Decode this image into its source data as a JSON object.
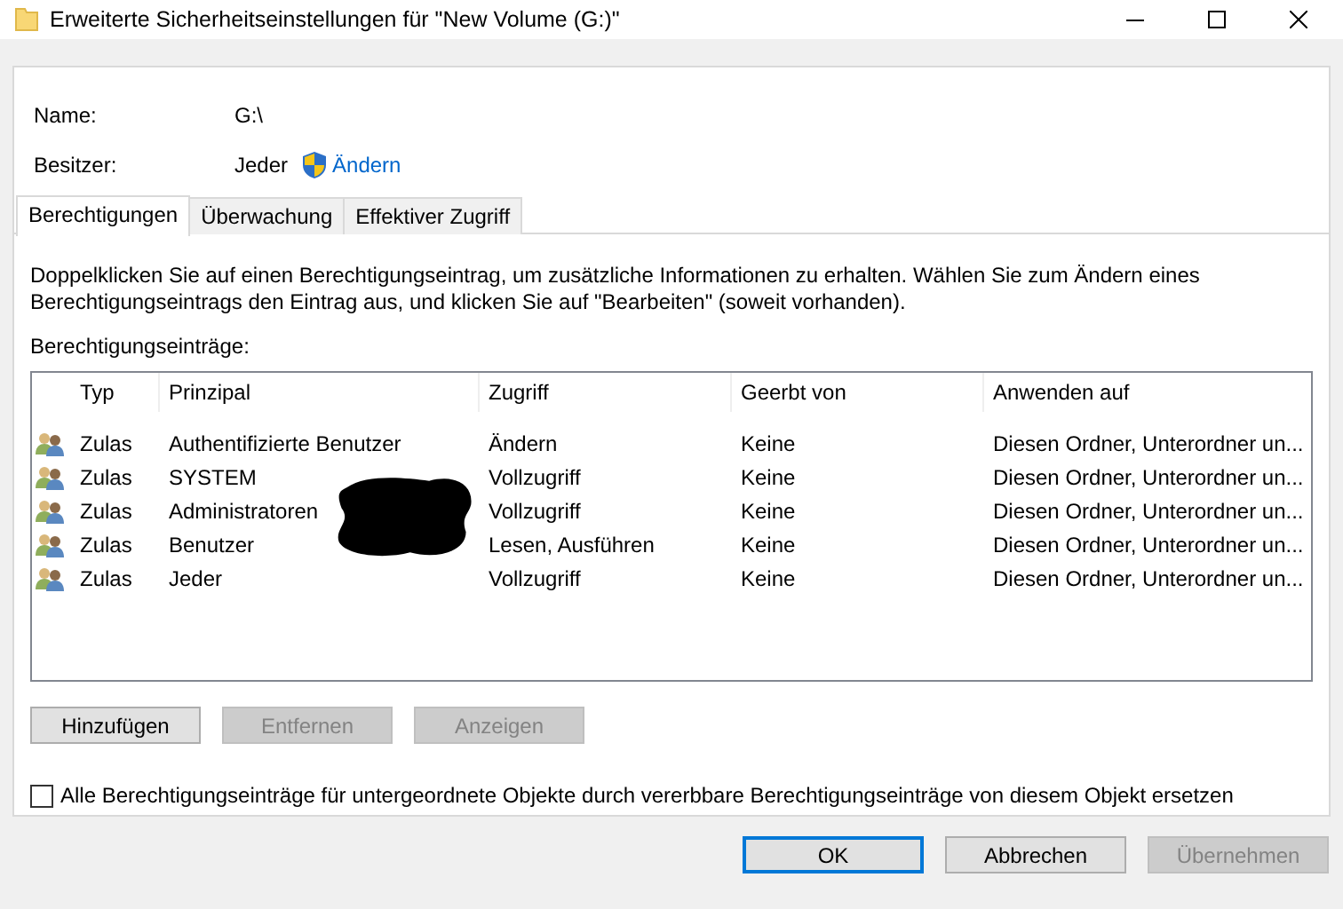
{
  "window": {
    "title": "Erweiterte Sicherheitseinstellungen für \"New Volume (G:)\""
  },
  "name": {
    "label": "Name:",
    "value": "G:\\"
  },
  "owner": {
    "label": "Besitzer:",
    "value": "Jeder",
    "link": "Ändern"
  },
  "tabs": [
    {
      "label": "Berechtigungen",
      "selected": true
    },
    {
      "label": "Überwachung",
      "selected": false
    },
    {
      "label": "Effektiver Zugriff",
      "selected": false
    }
  ],
  "description": "Doppelklicken Sie auf einen Berechtigungseintrag, um zusätzliche Informationen zu erhalten. Wählen Sie zum Ändern eines Berechtigungseintrags den Eintrag aus, und klicken Sie auf \"Bearbeiten\" (soweit vorhanden).",
  "entries_label": "Berechtigungseinträge:",
  "table": {
    "columns": [
      "Typ",
      "Prinzipal",
      "Zugriff",
      "Geerbt von",
      "Anwenden auf"
    ],
    "rows": [
      {
        "cells": [
          "Zulas",
          "Authentifizierte Benutzer",
          "Ändern",
          "Keine",
          "Diesen Ordner, Unterordner un..."
        ]
      },
      {
        "cells": [
          "Zulas",
          "SYSTEM",
          "Vollzugriff",
          "Keine",
          "Diesen Ordner, Unterordner un..."
        ]
      },
      {
        "cells": [
          "Zulas",
          "Administratoren",
          "Vollzugriff",
          "Keine",
          "Diesen Ordner, Unterordner un..."
        ]
      },
      {
        "cells": [
          "Zulas",
          "Benutzer",
          "Lesen, Ausführen",
          "Keine",
          "Diesen Ordner, Unterordner un..."
        ]
      },
      {
        "cells": [
          "Zulas",
          "Jeder",
          "Vollzugriff",
          "Keine",
          "Diesen Ordner, Unterordner un..."
        ]
      }
    ]
  },
  "entry_buttons": [
    {
      "label": "Hinzufügen",
      "disabled": false
    },
    {
      "label": "Entfernen",
      "disabled": true
    },
    {
      "label": "Anzeigen",
      "disabled": true
    }
  ],
  "replace_checkbox": {
    "label": "Alle Berechtigungseinträge für untergeordnete Objekte durch vererbbare Berechtigungseinträge von diesem Objekt ersetzen",
    "checked": false
  },
  "footer_buttons": [
    {
      "label": "OK",
      "disabled": false,
      "focused": true
    },
    {
      "label": "Abbrechen",
      "disabled": false,
      "focused": false
    },
    {
      "label": "Übernehmen",
      "disabled": true,
      "focused": false
    }
  ]
}
